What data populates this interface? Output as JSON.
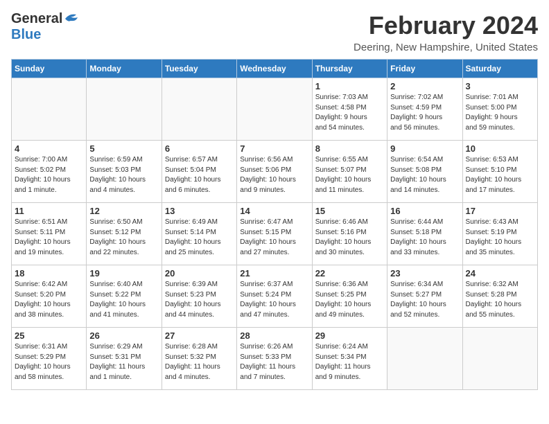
{
  "logo": {
    "general": "General",
    "blue": "Blue"
  },
  "title": "February 2024",
  "location": "Deering, New Hampshire, United States",
  "headers": [
    "Sunday",
    "Monday",
    "Tuesday",
    "Wednesday",
    "Thursday",
    "Friday",
    "Saturday"
  ],
  "weeks": [
    [
      {
        "day": "",
        "info": ""
      },
      {
        "day": "",
        "info": ""
      },
      {
        "day": "",
        "info": ""
      },
      {
        "day": "",
        "info": ""
      },
      {
        "day": "1",
        "info": "Sunrise: 7:03 AM\nSunset: 4:58 PM\nDaylight: 9 hours\nand 54 minutes."
      },
      {
        "day": "2",
        "info": "Sunrise: 7:02 AM\nSunset: 4:59 PM\nDaylight: 9 hours\nand 56 minutes."
      },
      {
        "day": "3",
        "info": "Sunrise: 7:01 AM\nSunset: 5:00 PM\nDaylight: 9 hours\nand 59 minutes."
      }
    ],
    [
      {
        "day": "4",
        "info": "Sunrise: 7:00 AM\nSunset: 5:02 PM\nDaylight: 10 hours\nand 1 minute."
      },
      {
        "day": "5",
        "info": "Sunrise: 6:59 AM\nSunset: 5:03 PM\nDaylight: 10 hours\nand 4 minutes."
      },
      {
        "day": "6",
        "info": "Sunrise: 6:57 AM\nSunset: 5:04 PM\nDaylight: 10 hours\nand 6 minutes."
      },
      {
        "day": "7",
        "info": "Sunrise: 6:56 AM\nSunset: 5:06 PM\nDaylight: 10 hours\nand 9 minutes."
      },
      {
        "day": "8",
        "info": "Sunrise: 6:55 AM\nSunset: 5:07 PM\nDaylight: 10 hours\nand 11 minutes."
      },
      {
        "day": "9",
        "info": "Sunrise: 6:54 AM\nSunset: 5:08 PM\nDaylight: 10 hours\nand 14 minutes."
      },
      {
        "day": "10",
        "info": "Sunrise: 6:53 AM\nSunset: 5:10 PM\nDaylight: 10 hours\nand 17 minutes."
      }
    ],
    [
      {
        "day": "11",
        "info": "Sunrise: 6:51 AM\nSunset: 5:11 PM\nDaylight: 10 hours\nand 19 minutes."
      },
      {
        "day": "12",
        "info": "Sunrise: 6:50 AM\nSunset: 5:12 PM\nDaylight: 10 hours\nand 22 minutes."
      },
      {
        "day": "13",
        "info": "Sunrise: 6:49 AM\nSunset: 5:14 PM\nDaylight: 10 hours\nand 25 minutes."
      },
      {
        "day": "14",
        "info": "Sunrise: 6:47 AM\nSunset: 5:15 PM\nDaylight: 10 hours\nand 27 minutes."
      },
      {
        "day": "15",
        "info": "Sunrise: 6:46 AM\nSunset: 5:16 PM\nDaylight: 10 hours\nand 30 minutes."
      },
      {
        "day": "16",
        "info": "Sunrise: 6:44 AM\nSunset: 5:18 PM\nDaylight: 10 hours\nand 33 minutes."
      },
      {
        "day": "17",
        "info": "Sunrise: 6:43 AM\nSunset: 5:19 PM\nDaylight: 10 hours\nand 35 minutes."
      }
    ],
    [
      {
        "day": "18",
        "info": "Sunrise: 6:42 AM\nSunset: 5:20 PM\nDaylight: 10 hours\nand 38 minutes."
      },
      {
        "day": "19",
        "info": "Sunrise: 6:40 AM\nSunset: 5:22 PM\nDaylight: 10 hours\nand 41 minutes."
      },
      {
        "day": "20",
        "info": "Sunrise: 6:39 AM\nSunset: 5:23 PM\nDaylight: 10 hours\nand 44 minutes."
      },
      {
        "day": "21",
        "info": "Sunrise: 6:37 AM\nSunset: 5:24 PM\nDaylight: 10 hours\nand 47 minutes."
      },
      {
        "day": "22",
        "info": "Sunrise: 6:36 AM\nSunset: 5:25 PM\nDaylight: 10 hours\nand 49 minutes."
      },
      {
        "day": "23",
        "info": "Sunrise: 6:34 AM\nSunset: 5:27 PM\nDaylight: 10 hours\nand 52 minutes."
      },
      {
        "day": "24",
        "info": "Sunrise: 6:32 AM\nSunset: 5:28 PM\nDaylight: 10 hours\nand 55 minutes."
      }
    ],
    [
      {
        "day": "25",
        "info": "Sunrise: 6:31 AM\nSunset: 5:29 PM\nDaylight: 10 hours\nand 58 minutes."
      },
      {
        "day": "26",
        "info": "Sunrise: 6:29 AM\nSunset: 5:31 PM\nDaylight: 11 hours\nand 1 minute."
      },
      {
        "day": "27",
        "info": "Sunrise: 6:28 AM\nSunset: 5:32 PM\nDaylight: 11 hours\nand 4 minutes."
      },
      {
        "day": "28",
        "info": "Sunrise: 6:26 AM\nSunset: 5:33 PM\nDaylight: 11 hours\nand 7 minutes."
      },
      {
        "day": "29",
        "info": "Sunrise: 6:24 AM\nSunset: 5:34 PM\nDaylight: 11 hours\nand 9 minutes."
      },
      {
        "day": "",
        "info": ""
      },
      {
        "day": "",
        "info": ""
      }
    ]
  ]
}
